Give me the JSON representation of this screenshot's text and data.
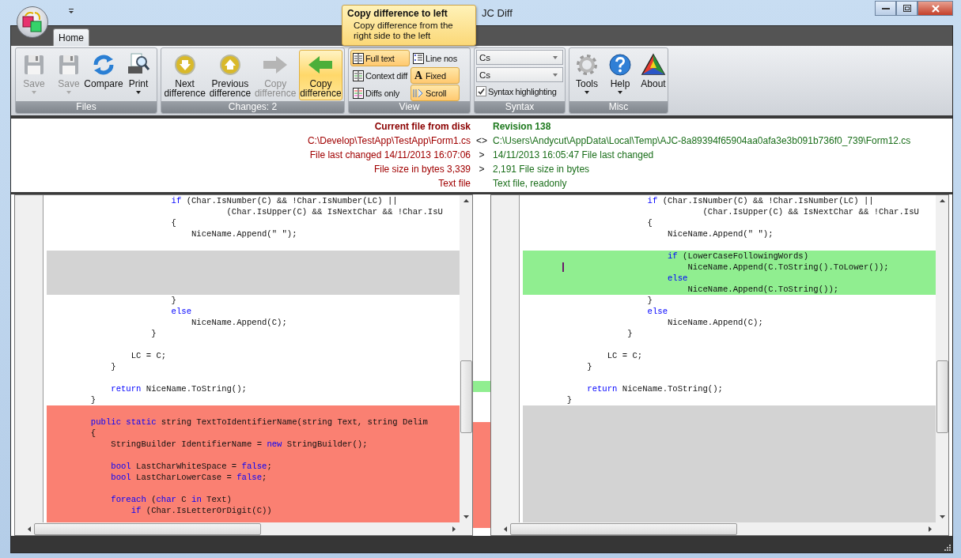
{
  "window": {
    "title": "JC Diff"
  },
  "tabs": [
    {
      "label": "Home",
      "selected": true
    }
  ],
  "ribbon": {
    "groups": [
      {
        "label": "Files",
        "kind": "buttons",
        "buttons": [
          {
            "label": "Save",
            "disabled": true,
            "hovered": false,
            "dropdown": true
          },
          {
            "label": "Save",
            "disabled": true,
            "hovered": false,
            "dropdown": true
          },
          {
            "label": "Compare",
            "disabled": false,
            "hovered": false,
            "dropdown": false
          },
          {
            "label": "Print",
            "disabled": false,
            "hovered": false,
            "dropdown": true
          }
        ]
      },
      {
        "label": "Changes: 2",
        "kind": "buttons",
        "buttons": [
          {
            "label": "Next difference",
            "disabled": false,
            "hovered": false,
            "dropdown": false
          },
          {
            "label": "Previous difference",
            "disabled": false,
            "hovered": false,
            "dropdown": false
          },
          {
            "label": "Copy difference",
            "disabled": true,
            "hovered": false,
            "dropdown": false
          },
          {
            "label": "Copy difference",
            "disabled": false,
            "hovered": true,
            "dropdown": false
          }
        ]
      },
      {
        "label": "View",
        "kind": "toggles",
        "toggles": [
          {
            "label": "Full text",
            "on": true
          },
          {
            "label": "Line nos",
            "on": false
          },
          {
            "label": "Context diff",
            "on": false
          },
          {
            "label": "Fixed",
            "glyph": "A",
            "on": true
          },
          {
            "label": "Diffs only",
            "on": false
          },
          {
            "label": "Scroll",
            "on": true
          }
        ]
      },
      {
        "label": "Syntax",
        "kind": "syntax",
        "dropdowns": [
          {
            "value": "Cs"
          },
          {
            "value": "Cs"
          }
        ],
        "checkbox": {
          "label": "Syntax highlighting",
          "checked": true
        }
      },
      {
        "label": "Misc",
        "kind": "buttons",
        "buttons": [
          {
            "label": "Tools",
            "disabled": false,
            "hovered": false,
            "dropdown": true
          },
          {
            "label": "Help",
            "disabled": false,
            "hovered": false,
            "dropdown": true
          },
          {
            "label": "About",
            "disabled": false,
            "hovered": false,
            "dropdown": false
          }
        ]
      }
    ]
  },
  "tooltip": {
    "title": "Copy difference to left",
    "text": "Copy difference from the right side to the left"
  },
  "comparison": {
    "left_heading": "Current file from disk",
    "right_heading": "Revision 138",
    "rows": [
      {
        "left": "C:\\Develop\\TestApp\\TestApp\\Form1.cs",
        "separator": "<>",
        "right": "C:\\Users\\Andycut\\AppData\\Local\\Temp\\AJC-8a89394f65904aa0afa3e3b091b736f0_739\\Form12.cs"
      },
      {
        "left": "File last changed 14/11/2013 16:07:06",
        "separator": ">",
        "right": "14/11/2013 16:05:47 File last changed"
      },
      {
        "left": "File size in bytes 3,339",
        "separator": ">",
        "right": "2,191 File size in bytes"
      },
      {
        "left": "Text file",
        "right": "Text file, readonly"
      }
    ]
  },
  "left_pane": {
    "lines": [
      {
        "kind": "same",
        "segments": [
          {
            "text": "                        if",
            "kind": "keyword"
          },
          {
            "text": " (Char.IsNumber(C) && !Char.IsNumber(LC) ||",
            "kind": "plain"
          }
        ]
      },
      {
        "kind": "same",
        "segments": [
          {
            "text": "                                   (Char.IsUpper(C) && IsNextChar && !Char.IsU",
            "kind": "plain"
          }
        ]
      },
      {
        "kind": "same",
        "segments": [
          {
            "text": "                        {",
            "kind": "plain"
          }
        ]
      },
      {
        "kind": "same",
        "segments": [
          {
            "text": "                            NiceName.Append(\" \");",
            "kind": "plain"
          }
        ]
      },
      {
        "kind": "same"
      },
      {
        "kind": "filler"
      },
      {
        "kind": "filler"
      },
      {
        "kind": "filler"
      },
      {
        "kind": "filler"
      },
      {
        "kind": "same",
        "segments": [
          {
            "text": "                        }",
            "kind": "plain"
          }
        ]
      },
      {
        "kind": "same",
        "segments": [
          {
            "text": "                        else",
            "kind": "keyword"
          }
        ]
      },
      {
        "kind": "same",
        "segments": [
          {
            "text": "                            NiceName.Append(C);",
            "kind": "plain"
          }
        ]
      },
      {
        "kind": "same",
        "segments": [
          {
            "text": "                    }",
            "kind": "plain"
          }
        ]
      },
      {
        "kind": "same"
      },
      {
        "kind": "same",
        "segments": [
          {
            "text": "                LC = C;",
            "kind": "plain"
          }
        ]
      },
      {
        "kind": "same",
        "segments": [
          {
            "text": "            }",
            "kind": "plain"
          }
        ]
      },
      {
        "kind": "same"
      },
      {
        "kind": "same",
        "segments": [
          {
            "text": "            return",
            "kind": "keyword"
          },
          {
            "text": " NiceName.ToString();",
            "kind": "plain"
          }
        ]
      },
      {
        "kind": "same",
        "segments": [
          {
            "text": "        }",
            "kind": "plain"
          }
        ]
      },
      {
        "kind": "removed"
      },
      {
        "kind": "removed",
        "segments": [
          {
            "text": "        public static",
            "kind": "keyword"
          },
          {
            "text": " string TextToIdentifierName(string Text, string Delim",
            "kind": "plain"
          }
        ]
      },
      {
        "kind": "removed",
        "segments": [
          {
            "text": "        {",
            "kind": "plain"
          }
        ]
      },
      {
        "kind": "removed",
        "segments": [
          {
            "text": "            StringBuilder IdentifierName = ",
            "kind": "plain"
          },
          {
            "text": "new",
            "kind": "keyword"
          },
          {
            "text": " StringBuilder();",
            "kind": "plain"
          }
        ]
      },
      {
        "kind": "removed"
      },
      {
        "kind": "removed",
        "segments": [
          {
            "text": "            bool",
            "kind": "keyword"
          },
          {
            "text": " LastCharWhiteSpace = ",
            "kind": "plain"
          },
          {
            "text": "false",
            "kind": "keyword"
          },
          {
            "text": ";",
            "kind": "plain"
          }
        ]
      },
      {
        "kind": "removed",
        "segments": [
          {
            "text": "            bool",
            "kind": "keyword"
          },
          {
            "text": " LastCharLowerCase = ",
            "kind": "plain"
          },
          {
            "text": "false",
            "kind": "keyword"
          },
          {
            "text": ";",
            "kind": "plain"
          }
        ]
      },
      {
        "kind": "removed"
      },
      {
        "kind": "removed",
        "segments": [
          {
            "text": "            foreach",
            "kind": "keyword"
          },
          {
            "text": " (",
            "kind": "plain"
          },
          {
            "text": "char",
            "kind": "keyword"
          },
          {
            "text": " C ",
            "kind": "plain"
          },
          {
            "text": "in",
            "kind": "keyword"
          },
          {
            "text": " Text)",
            "kind": "plain"
          }
        ]
      },
      {
        "kind": "removed",
        "segments": [
          {
            "text": "                if",
            "kind": "keyword"
          },
          {
            "text": " (Char.IsLetterOrDigit(C))",
            "kind": "plain"
          }
        ]
      },
      {
        "kind": "removed"
      }
    ]
  },
  "right_pane": {
    "lines": [
      {
        "kind": "same",
        "segments": [
          {
            "text": "                        if",
            "kind": "keyword"
          },
          {
            "text": " (Char.IsNumber(C) && !Char.IsNumber(LC) ||",
            "kind": "plain"
          }
        ]
      },
      {
        "kind": "same",
        "segments": [
          {
            "text": "                                   (Char.IsUpper(C) && IsNextChar && !Char.IsU",
            "kind": "plain"
          }
        ]
      },
      {
        "kind": "same",
        "segments": [
          {
            "text": "                        {",
            "kind": "plain"
          }
        ]
      },
      {
        "kind": "same",
        "segments": [
          {
            "text": "                            NiceName.Append(\" \");",
            "kind": "plain"
          }
        ]
      },
      {
        "kind": "same"
      },
      {
        "kind": "added",
        "segments": [
          {
            "text": "                            if",
            "kind": "keyword"
          },
          {
            "text": " (LowerCaseFollowingWords)",
            "kind": "plain"
          }
        ]
      },
      {
        "kind": "added",
        "caret": true,
        "segments": [
          {
            "text": "                                NiceName.Append(C.ToString().ToLower());",
            "kind": "plain"
          }
        ]
      },
      {
        "kind": "added",
        "segments": [
          {
            "text": "                            else",
            "kind": "keyword"
          }
        ]
      },
      {
        "kind": "added",
        "segments": [
          {
            "text": "                                NiceName.Append(C.ToString());",
            "kind": "plain"
          }
        ]
      },
      {
        "kind": "same",
        "segments": [
          {
            "text": "                        }",
            "kind": "plain"
          }
        ]
      },
      {
        "kind": "same",
        "segments": [
          {
            "text": "                        else",
            "kind": "keyword"
          }
        ]
      },
      {
        "kind": "same",
        "segments": [
          {
            "text": "                            NiceName.Append(C);",
            "kind": "plain"
          }
        ]
      },
      {
        "kind": "same",
        "segments": [
          {
            "text": "                    }",
            "kind": "plain"
          }
        ]
      },
      {
        "kind": "same"
      },
      {
        "kind": "same",
        "segments": [
          {
            "text": "                LC = C;",
            "kind": "plain"
          }
        ]
      },
      {
        "kind": "same",
        "segments": [
          {
            "text": "            }",
            "kind": "plain"
          }
        ]
      },
      {
        "kind": "same"
      },
      {
        "kind": "same",
        "segments": [
          {
            "text": "            return",
            "kind": "keyword"
          },
          {
            "text": " NiceName.ToString();",
            "kind": "plain"
          }
        ]
      },
      {
        "kind": "same",
        "segments": [
          {
            "text": "        }",
            "kind": "plain"
          }
        ]
      },
      {
        "kind": "filler"
      },
      {
        "kind": "filler"
      },
      {
        "kind": "filler"
      },
      {
        "kind": "filler"
      },
      {
        "kind": "filler"
      },
      {
        "kind": "filler"
      },
      {
        "kind": "filler"
      },
      {
        "kind": "filler"
      },
      {
        "kind": "filler"
      },
      {
        "kind": "filler"
      },
      {
        "kind": "filler"
      }
    ]
  }
}
